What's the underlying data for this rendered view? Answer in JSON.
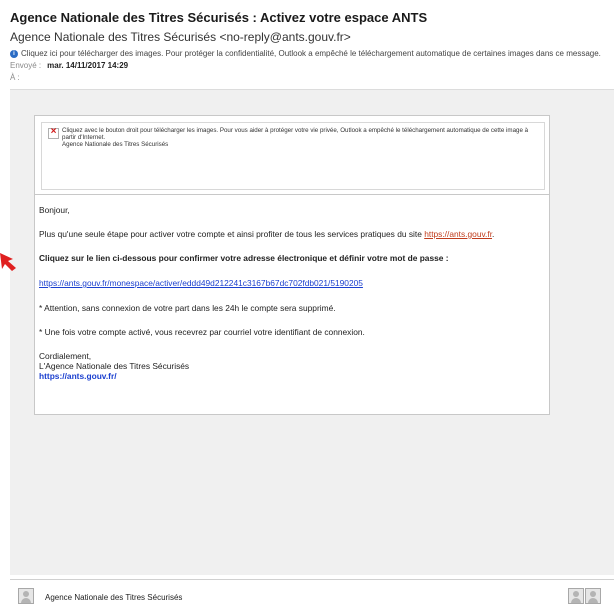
{
  "email": {
    "subject": "Agence Nationale des Titres Sécurisés : Activez votre espace ANTS",
    "sender": "Agence Nationale des Titres Sécurisés <no-reply@ants.gouv.fr>",
    "info_bar": "Cliquez ici pour télécharger des images. Pour protéger la confidentialité, Outlook a empêché le téléchargement automatique de certaines images dans ce message.",
    "sent_label": "Envoyé :",
    "sent_value": "mar. 14/11/2017 14:29",
    "to_label": "À :"
  },
  "image_block": {
    "text": "Cliquez avec le bouton droit pour télécharger les images. Pour vous aider à protéger votre vie privée, Outlook a empêché le téléchargement automatique de cette image à partir d'Internet.",
    "alt": "Agence Nationale des Titres Sécurisés"
  },
  "body": {
    "greeting": "Bonjour,",
    "intro": "Plus qu'une seule étape pour activer votre compte et ainsi profiter de tous les services pratiques du site",
    "intro_link": "https://ants.gouv.fr",
    "intro_end": ".",
    "instruction": "Cliquez sur le lien ci-dessous pour confirmer votre adresse électronique et définir votre mot de passe :",
    "activation_link": "https://ants.gouv.fr/monespace/activer/eddd49d212241c3167b67dc702fdb021/5190205",
    "note1": "* Attention, sans connexion de votre part dans les 24h le compte sera supprimé.",
    "note2": "* Une fois votre compte activé, vous recevrez par courriel votre identifiant de connexion.",
    "closing": "Cordialement,",
    "signature_name": "L'Agence Nationale des Titres Sécurisés",
    "signature_url": "https://ants.gouv.fr/"
  },
  "footer": {
    "sender_name": "Agence Nationale des Titres Sécurisés"
  },
  "colors": {
    "arrow": "#e02020",
    "link": "#1a3fcf",
    "info_icon": "#2b6cc4"
  }
}
